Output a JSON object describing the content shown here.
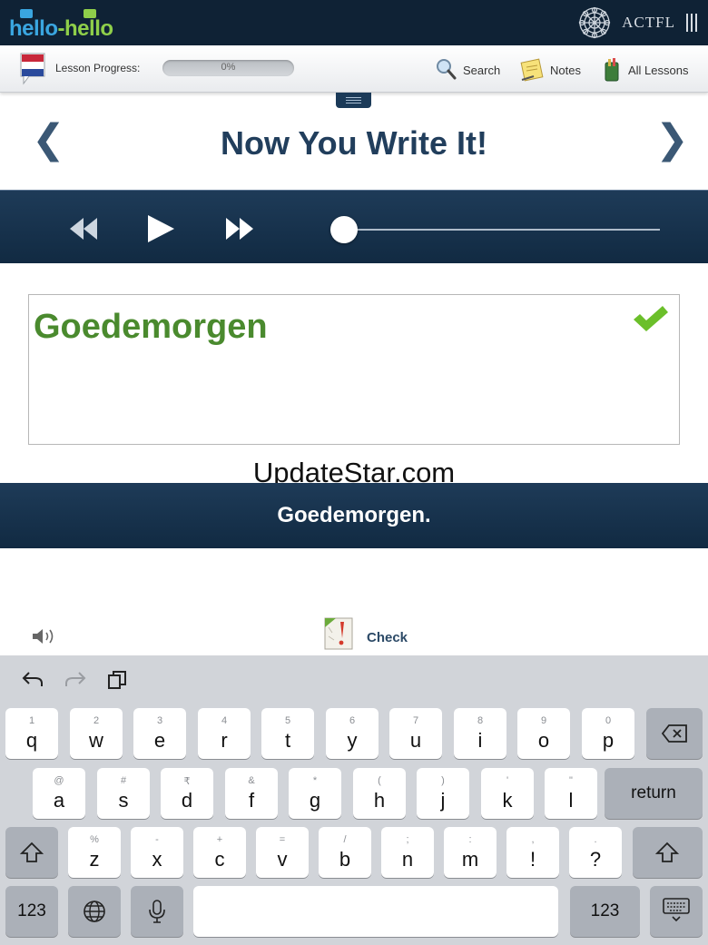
{
  "header": {
    "logo_text_left": "hello",
    "logo_text_dash": "-",
    "logo_text_right": "hello",
    "partner_name": "ACTFL"
  },
  "toolbar": {
    "lesson_progress_label": "Lesson Progress:",
    "progress_percent_text": "0%",
    "progress_value": 0,
    "search_label": "Search",
    "notes_label": "Notes",
    "all_lessons_label": "All Lessons"
  },
  "lesson": {
    "title": "Now You Write It!",
    "prev_glyph": "❮",
    "next_glyph": "❯"
  },
  "player": {
    "position_fraction": 0
  },
  "exercise": {
    "typed_answer": "Goedemorgen",
    "answer_correct": true,
    "correct_solution": "Goedemorgen.",
    "check_label": "Check"
  },
  "watermark": "UpdateStar.com",
  "keyboard": {
    "rows": [
      [
        {
          "p": "q",
          "s": "1"
        },
        {
          "p": "w",
          "s": "2"
        },
        {
          "p": "e",
          "s": "3"
        },
        {
          "p": "r",
          "s": "4"
        },
        {
          "p": "t",
          "s": "5"
        },
        {
          "p": "y",
          "s": "6"
        },
        {
          "p": "u",
          "s": "7"
        },
        {
          "p": "i",
          "s": "8"
        },
        {
          "p": "o",
          "s": "9"
        },
        {
          "p": "p",
          "s": "0"
        }
      ],
      [
        {
          "p": "a",
          "s": "@"
        },
        {
          "p": "s",
          "s": "#"
        },
        {
          "p": "d",
          "s": "₹"
        },
        {
          "p": "f",
          "s": "&"
        },
        {
          "p": "g",
          "s": "*"
        },
        {
          "p": "h",
          "s": "("
        },
        {
          "p": "j",
          "s": ")"
        },
        {
          "p": "k",
          "s": "'"
        },
        {
          "p": "l",
          "s": "\""
        }
      ],
      [
        {
          "p": "z",
          "s": "%"
        },
        {
          "p": "x",
          "s": "-"
        },
        {
          "p": "c",
          "s": "+"
        },
        {
          "p": "v",
          "s": "="
        },
        {
          "p": "b",
          "s": "/"
        },
        {
          "p": "n",
          "s": ";"
        },
        {
          "p": "m",
          "s": ":"
        },
        {
          "p": "!",
          "s": ","
        },
        {
          "p": "?",
          "s": "."
        }
      ]
    ],
    "return_label": "return",
    "numbers_label": "123"
  },
  "colors": {
    "navy": "#0f2235",
    "answer_green": "#4a8a2e",
    "title_blue": "#213e5c"
  }
}
